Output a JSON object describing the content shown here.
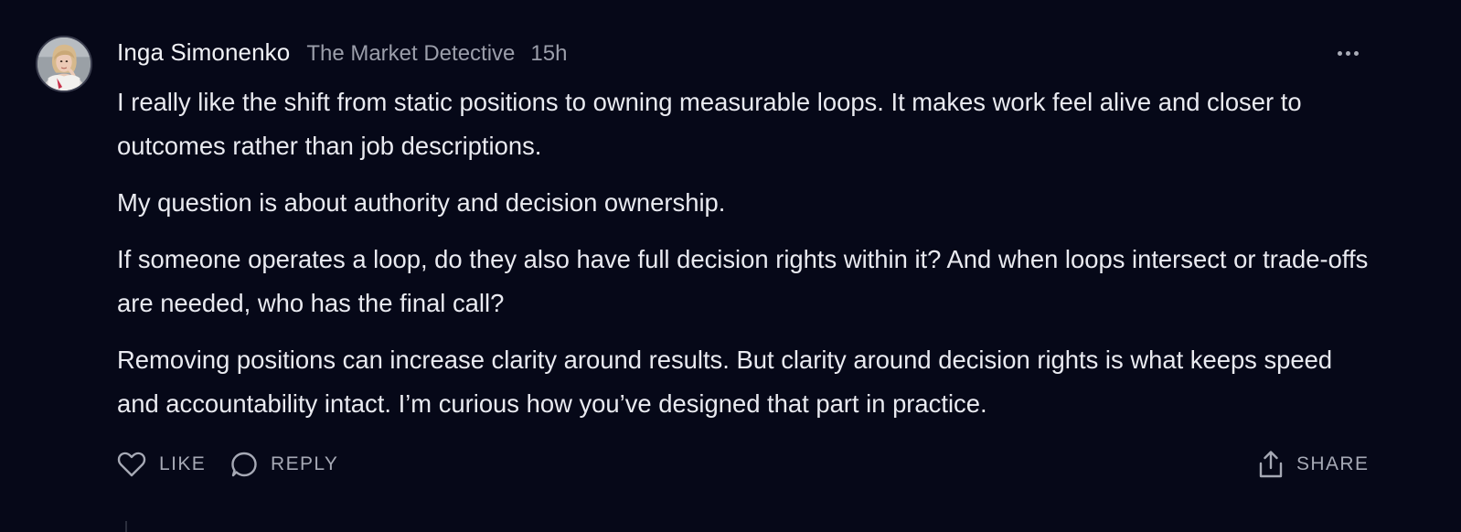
{
  "comment": {
    "author": "Inga Simonenko",
    "publication": "The Market Detective",
    "time": "15h",
    "paragraphs": [
      "I really like the shift from static positions to owning measurable loops. It makes work feel alive and closer to outcomes rather than job descriptions.",
      "My question is about authority and decision ownership.",
      "If someone operates a loop, do they also have full decision rights within it? And when loops intersect or trade-offs are needed, who has the final call?",
      "Removing positions can increase clarity around results. But clarity around decision rights is what keeps speed and accountability intact. I’m curious how you’ve designed that part in practice."
    ]
  },
  "actions": {
    "like_label": "LIKE",
    "reply_label": "REPLY",
    "share_label": "SHARE"
  },
  "icons": {
    "like": "heart-icon",
    "reply": "speech-bubble-icon",
    "share": "share-upload-icon",
    "more": "more-horizontal-icon"
  },
  "colors": {
    "background": "#060818",
    "text": "#e9eaf0",
    "muted": "#9b9eaa"
  }
}
